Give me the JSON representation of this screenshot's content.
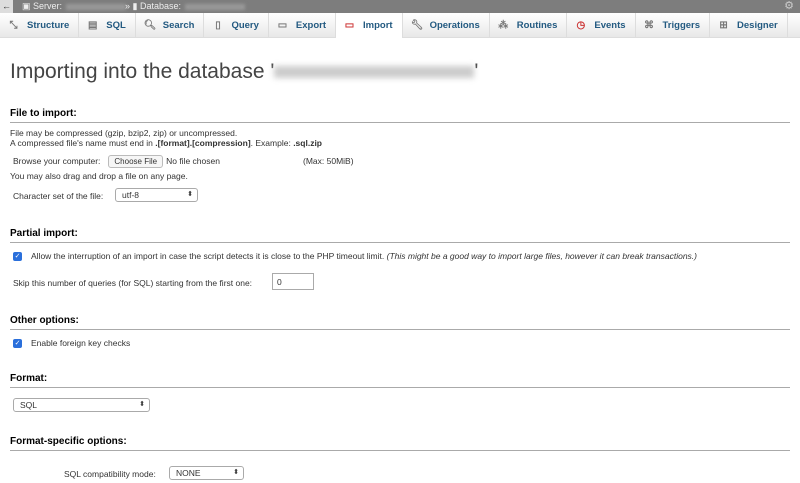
{
  "topbar": {
    "server_label": "Server:",
    "database_label": "Database:"
  },
  "tabs": [
    {
      "label": "Structure",
      "icon": "structure-icon"
    },
    {
      "label": "SQL",
      "icon": "sql-icon"
    },
    {
      "label": "Search",
      "icon": "search-icon"
    },
    {
      "label": "Query",
      "icon": "query-icon"
    },
    {
      "label": "Export",
      "icon": "export-icon"
    },
    {
      "label": "Import",
      "icon": "import-icon",
      "active": true
    },
    {
      "label": "Operations",
      "icon": "wrench-icon"
    },
    {
      "label": "Routines",
      "icon": "routines-icon"
    },
    {
      "label": "Events",
      "icon": "clock-icon"
    },
    {
      "label": "Triggers",
      "icon": "triggers-icon"
    },
    {
      "label": "Designer",
      "icon": "designer-icon"
    }
  ],
  "page_title": "Importing into the database '",
  "page_title_end": "'",
  "file_import": {
    "heading": "File to import:",
    "line1": "File may be compressed (gzip, bzip2, zip) or uncompressed.",
    "line2_pre": "A compressed file's name must end in ",
    "line2_bold": ".[format].[compression]",
    "line2_mid": ". Example: ",
    "line2_example": ".sql.zip",
    "browse_label": "Browse your computer:",
    "choose_button": "Choose File",
    "no_file": "No file chosen",
    "max": "(Max: 50MiB)",
    "drag_note": "You may also drag and drop a file on any page.",
    "charset_label": "Character set of the file:",
    "charset_value": "utf-8"
  },
  "partial": {
    "heading": "Partial import:",
    "allow_label": "Allow the interruption of an import in case the script detects it is close to the PHP timeout limit.",
    "allow_note": "(This might be a good way to import large files, however it can break transactions.)",
    "allow_checked": true,
    "skip_label": "Skip this number of queries (for SQL) starting from the first one:",
    "skip_value": "0"
  },
  "other": {
    "heading": "Other options:",
    "fk_label": "Enable foreign key checks",
    "fk_checked": true
  },
  "format": {
    "heading": "Format:",
    "value": "SQL"
  },
  "format_specific": {
    "heading": "Format-specific options:",
    "compat_label": "SQL compatibility mode:",
    "compat_value": "NONE"
  }
}
